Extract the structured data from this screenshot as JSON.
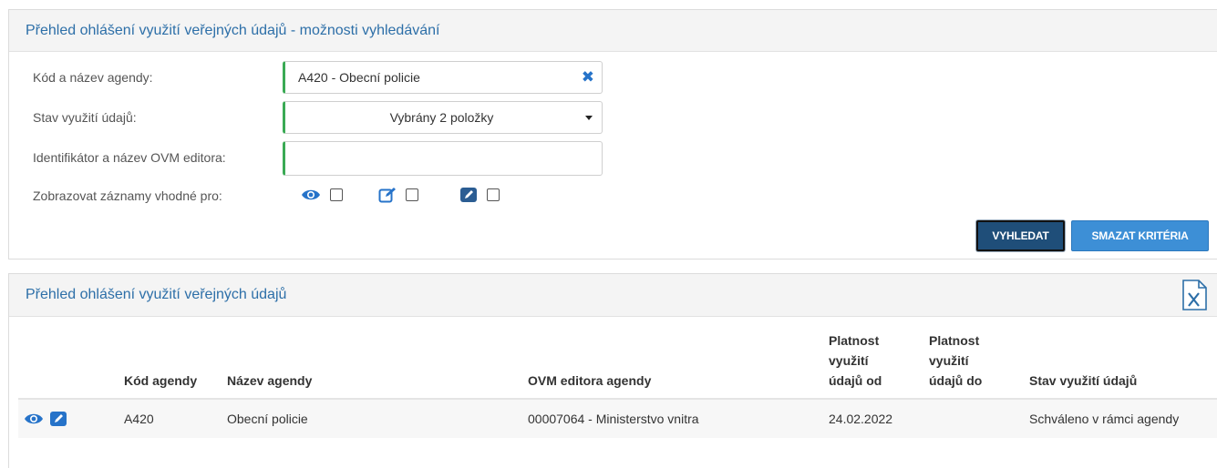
{
  "search_panel": {
    "title": "Přehled ohlášení využití veřejných údajů - možnosti vyhledávání",
    "agenda_label": "Kód a název agendy:",
    "agenda_value": "A420 - Obecní policie",
    "state_label": "Stav využití údajů:",
    "state_value": "Vybrány 2 položky",
    "editor_label": "Identifikátor a název OVM editora:",
    "editor_value": "",
    "show_label": "Zobrazovat záznamy vhodné pro:",
    "show_options": [
      {
        "icon": "eye-icon",
        "checked": false
      },
      {
        "icon": "edit-outline-icon",
        "checked": false
      },
      {
        "icon": "edit-solid-icon",
        "checked": false
      }
    ],
    "search_button": "VYHLEDAT",
    "clear_button": "SMAZAT KRITÉRIA",
    "clear_symbol": "✖"
  },
  "results_panel": {
    "title": "Přehled ohlášení využití veřejných údajů",
    "export_icon": "excel-export-icon",
    "columns": [
      "",
      "Kód agendy",
      "Název agendy",
      "OVM editora agendy",
      "Platnost využití údajů od",
      "Platnost využití údajů do",
      "Stav využití údajů"
    ],
    "rows": [
      {
        "kod": "A420",
        "nazev": "Obecní policie",
        "ovm": "00007064 - Ministerstvo vnitra",
        "od": "24.02.2022",
        "do": "",
        "stav": "Schváleno v rámci agendy"
      }
    ]
  },
  "colors": {
    "title_blue": "#2d6fa8",
    "field_accent_green": "#3aaa54",
    "primary_dark": "#1f4e79",
    "secondary_blue": "#3d8fd6",
    "icon_blue": "#2673c9"
  }
}
